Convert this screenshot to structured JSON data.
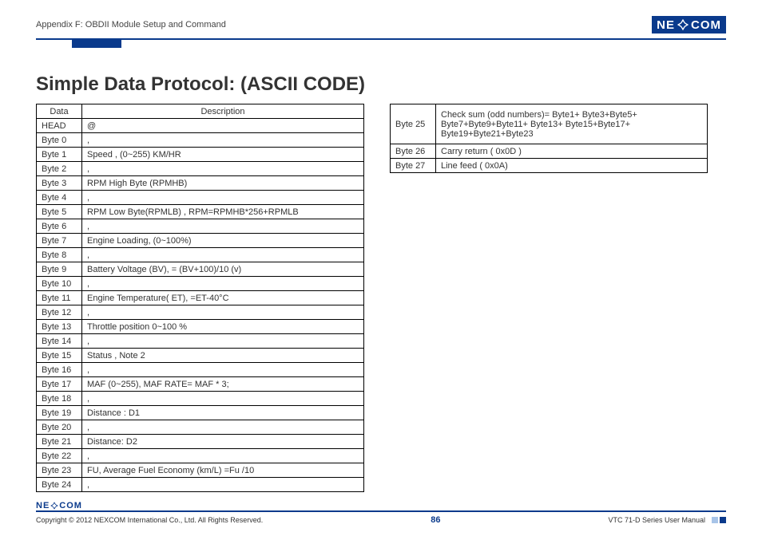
{
  "header": {
    "appendix": "Appendix F: OBDII Module Setup and Command",
    "logo_pre": "NE",
    "logo_post": "COM"
  },
  "title": "Simple Data Protocol: (ASCII CODE)",
  "table1": {
    "head_data": "Data",
    "head_desc": "Description",
    "rows": [
      {
        "k": "HEAD",
        "v": "@"
      },
      {
        "k": "Byte 0",
        "v": ","
      },
      {
        "k": "Byte 1",
        "v": "Speed , (0~255) KM/HR"
      },
      {
        "k": "Byte 2",
        "v": ","
      },
      {
        "k": "Byte 3",
        "v": "RPM High Byte (RPMHB)"
      },
      {
        "k": "Byte 4",
        "v": ","
      },
      {
        "k": "Byte 5",
        "v": "RPM Low Byte(RPMLB) , RPM=RPMHB*256+RPMLB"
      },
      {
        "k": "Byte 6",
        "v": ","
      },
      {
        "k": "Byte 7",
        "v": "Engine Loading, (0~100%)"
      },
      {
        "k": "Byte 8",
        "v": ","
      },
      {
        "k": "Byte 9",
        "v": "Battery Voltage (BV), = (BV+100)/10 (v)"
      },
      {
        "k": "Byte 10",
        "v": ","
      },
      {
        "k": "Byte 11",
        "v": "Engine Temperature( ET), =ET-40°C"
      },
      {
        "k": "Byte 12",
        "v": ","
      },
      {
        "k": "Byte 13",
        "v": "Throttle position 0~100 %"
      },
      {
        "k": "Byte 14",
        "v": ","
      },
      {
        "k": "Byte 15",
        "v": "Status , Note 2"
      },
      {
        "k": "Byte 16",
        "v": ","
      },
      {
        "k": "Byte 17",
        "v": "MAF (0~255), MAF RATE= MAF * 3;"
      },
      {
        "k": "Byte 18",
        "v": ","
      },
      {
        "k": "Byte 19",
        "v": "Distance : D1"
      },
      {
        "k": "Byte 20",
        "v": ","
      },
      {
        "k": "Byte 21",
        "v": "Distance: D2"
      },
      {
        "k": "Byte 22",
        "v": ","
      },
      {
        "k": "Byte 23",
        "v": "FU, Average Fuel Economy (km/L) =Fu /10"
      },
      {
        "k": "Byte 24",
        "v": ","
      }
    ]
  },
  "table2": {
    "rows": [
      {
        "k": "Byte 25",
        "v": "Check sum (odd numbers)= Byte1+ Byte3+Byte5+ Byte7+Byte9+Byte11+ Byte13+ Byte15+Byte17+ Byte19+Byte21+Byte23",
        "tall": true
      },
      {
        "k": "Byte 26",
        "v": "Carry return ( 0x0D )"
      },
      {
        "k": "Byte 27",
        "v": "Line feed ( 0x0A)"
      }
    ]
  },
  "footer": {
    "copyright": "Copyright © 2012 NEXCOM International Co., Ltd. All Rights Reserved.",
    "page": "86",
    "manual": "VTC 71-D Series User Manual",
    "logo_pre": "NE",
    "logo_post": "COM"
  }
}
